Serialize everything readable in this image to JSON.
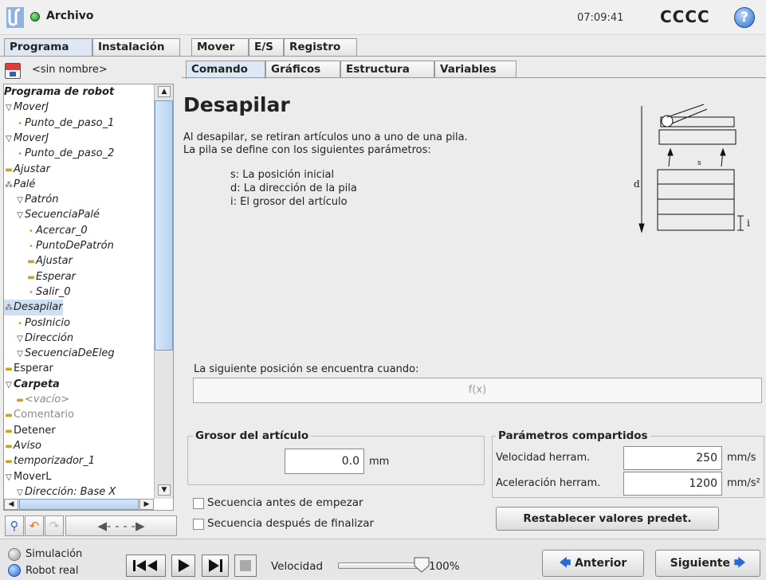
{
  "topbar": {
    "app_title": "Archivo",
    "clock": "07:09:41",
    "robot_name": "CCCC",
    "help_label": "?"
  },
  "main_tabs": [
    "Programa",
    "Instalación",
    "Mover",
    "E/S",
    "Registro"
  ],
  "program": {
    "name": "<sin nombre>"
  },
  "tree": [
    {
      "label": "Programa de robot",
      "style": "bold-italic"
    },
    {
      "label": "MoverJ",
      "glyph": "▽"
    },
    {
      "label": "Punto_de_paso_1",
      "glyph": "•"
    },
    {
      "label": "MoverJ",
      "glyph": "▽"
    },
    {
      "label": "Punto_de_paso_2",
      "glyph": "•"
    },
    {
      "label": "Ajustar",
      "glyph": "▬"
    },
    {
      "label": "Palé",
      "glyph": "⁂"
    },
    {
      "label": "Patrón",
      "glyph": "▽"
    },
    {
      "label": "SecuenciaPalé",
      "glyph": "▽"
    },
    {
      "label": "Acercar_0",
      "glyph": "•"
    },
    {
      "label": "PuntoDePatrón",
      "glyph": "•"
    },
    {
      "label": "Ajustar",
      "glyph": "▬"
    },
    {
      "label": "Esperar",
      "glyph": "▬"
    },
    {
      "label": "Salir_0",
      "glyph": "•"
    },
    {
      "label": "Desapilar",
      "glyph": "⁂"
    },
    {
      "label": "PosInicio",
      "glyph": "•"
    },
    {
      "label": "Dirección",
      "glyph": "▽"
    },
    {
      "label": "SecuenciaDeEleg",
      "glyph": "▽"
    },
    {
      "label": "Esperar",
      "glyph": "▬"
    },
    {
      "label": "Carpeta",
      "glyph": "▽"
    },
    {
      "label": "<vacío>",
      "glyph": "▬"
    },
    {
      "label": "Comentario",
      "glyph": "▬"
    },
    {
      "label": "Detener",
      "glyph": "▬"
    },
    {
      "label": "Aviso",
      "glyph": "▬"
    },
    {
      "label": "temporizador_1",
      "glyph": "▬"
    },
    {
      "label": "MoverL",
      "glyph": "▽"
    },
    {
      "label": "Dirección: Base X",
      "glyph": "▽"
    }
  ],
  "content_tabs": [
    "Comando",
    "Gráficos",
    "Estructura",
    "Variables"
  ],
  "command": {
    "title": "Desapilar",
    "desc_line1": "Al desapilar, se retiran artículos uno a uno de una pila.",
    "desc_line2": "La pila se define con los siguientes parámetros:",
    "params": [
      "s: La posición inicial",
      "d: La dirección de la pila",
      "i: El grosor del artículo"
    ],
    "diagram_labels": {
      "d": "d",
      "s": "s",
      "i": "i"
    },
    "next_position_label": "La siguiente posición se encuentra cuando:",
    "fx_placeholder": "f(x)"
  },
  "thickness": {
    "title": "Grosor del artículo",
    "value": "0.0",
    "unit": "mm"
  },
  "shared": {
    "title": "Parámetros compartidos",
    "speed_label": "Velocidad herram.",
    "speed_value": "250",
    "speed_unit": "mm/s",
    "accel_label": "Aceleración herram.",
    "accel_value": "1200",
    "accel_unit": "mm/s²",
    "reset_label": "Restablecer valores predet."
  },
  "checkboxes": {
    "before": "Secuencia antes de empezar",
    "after": "Secuencia después de finalizar"
  },
  "bottombar": {
    "mode_sim": "Simulación",
    "mode_real": "Robot real",
    "speed_label": "Velocidad",
    "speed_value": "100%",
    "speed_fraction": 1.0,
    "prev_label": "Anterior",
    "next_label": "Siguiente"
  },
  "colors": {
    "accent_blue": "#2a6bd1",
    "tab_active": "#dde8f5",
    "selection": "#cfe0f5"
  }
}
